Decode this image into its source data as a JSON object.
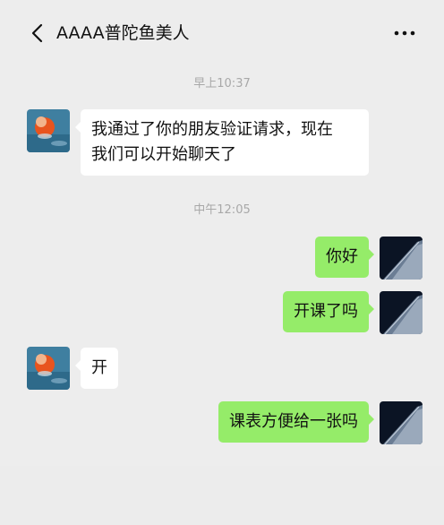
{
  "header": {
    "title": "AAAA普陀鱼美人",
    "back_icon": "chevron-left-icon",
    "more_icon": "ellipsis-icon"
  },
  "messages": [
    {
      "type": "time",
      "text": "早上10:37"
    },
    {
      "type": "incoming",
      "text_line1": "我通过了你的朋友验证请求，现在",
      "text_line2": "我们可以开始聊天了"
    },
    {
      "type": "time",
      "text": "中午12:05"
    },
    {
      "type": "outgoing",
      "text": "你好"
    },
    {
      "type": "outgoing",
      "text": "开课了吗"
    },
    {
      "type": "incoming",
      "text": "开"
    },
    {
      "type": "outgoing",
      "text": "课表方便给一张吗"
    }
  ],
  "colors": {
    "background": "#ededed",
    "incoming_bubble": "#ffffff",
    "outgoing_bubble": "#95ec69",
    "timestamp": "#a8a8a8"
  }
}
